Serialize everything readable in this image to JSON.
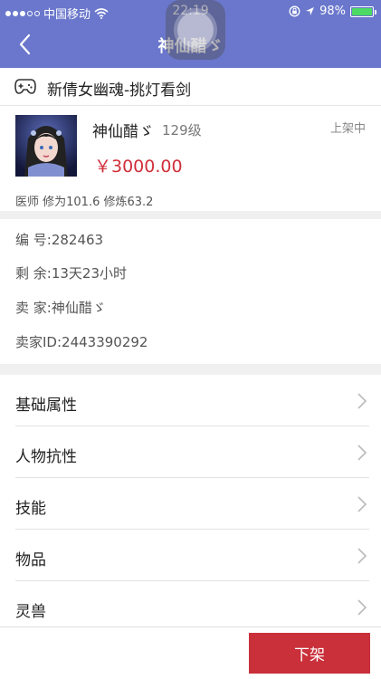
{
  "status_bar": {
    "carrier": "中国移动",
    "time": "22:19",
    "battery_percent": "98%",
    "battery_level": 0.98,
    "battery_color": "#4cd964"
  },
  "nav": {
    "title": "神仙醋ゞ",
    "back_icon": "chevron-left-icon",
    "bar_color": "#6a77cc"
  },
  "game": {
    "icon": "gamepad-icon",
    "name": "新倩女幽魂-挑灯看剑"
  },
  "role": {
    "name": "神仙醋ゞ",
    "level": "129级",
    "status": "上架中",
    "price": "￥3000.00",
    "price_color": "#d0303a",
    "meta": "医师 修为101.6 修炼63.2"
  },
  "info": {
    "id": "编   号:282463",
    "remaining": "剩   余:13天23小时",
    "seller": "卖   家:神仙醋ゞ",
    "seller_id": "卖家ID:2443390292"
  },
  "menu": [
    {
      "label": "基础属性",
      "icon": "chevron-right-icon"
    },
    {
      "label": "人物抗性",
      "icon": "chevron-right-icon"
    },
    {
      "label": "技能",
      "icon": "chevron-right-icon"
    },
    {
      "label": "物品",
      "icon": "chevron-right-icon"
    },
    {
      "label": "灵兽",
      "icon": "chevron-right-icon"
    }
  ],
  "actions": {
    "off_shelf": "下架",
    "off_shelf_color": "#c9303a"
  }
}
